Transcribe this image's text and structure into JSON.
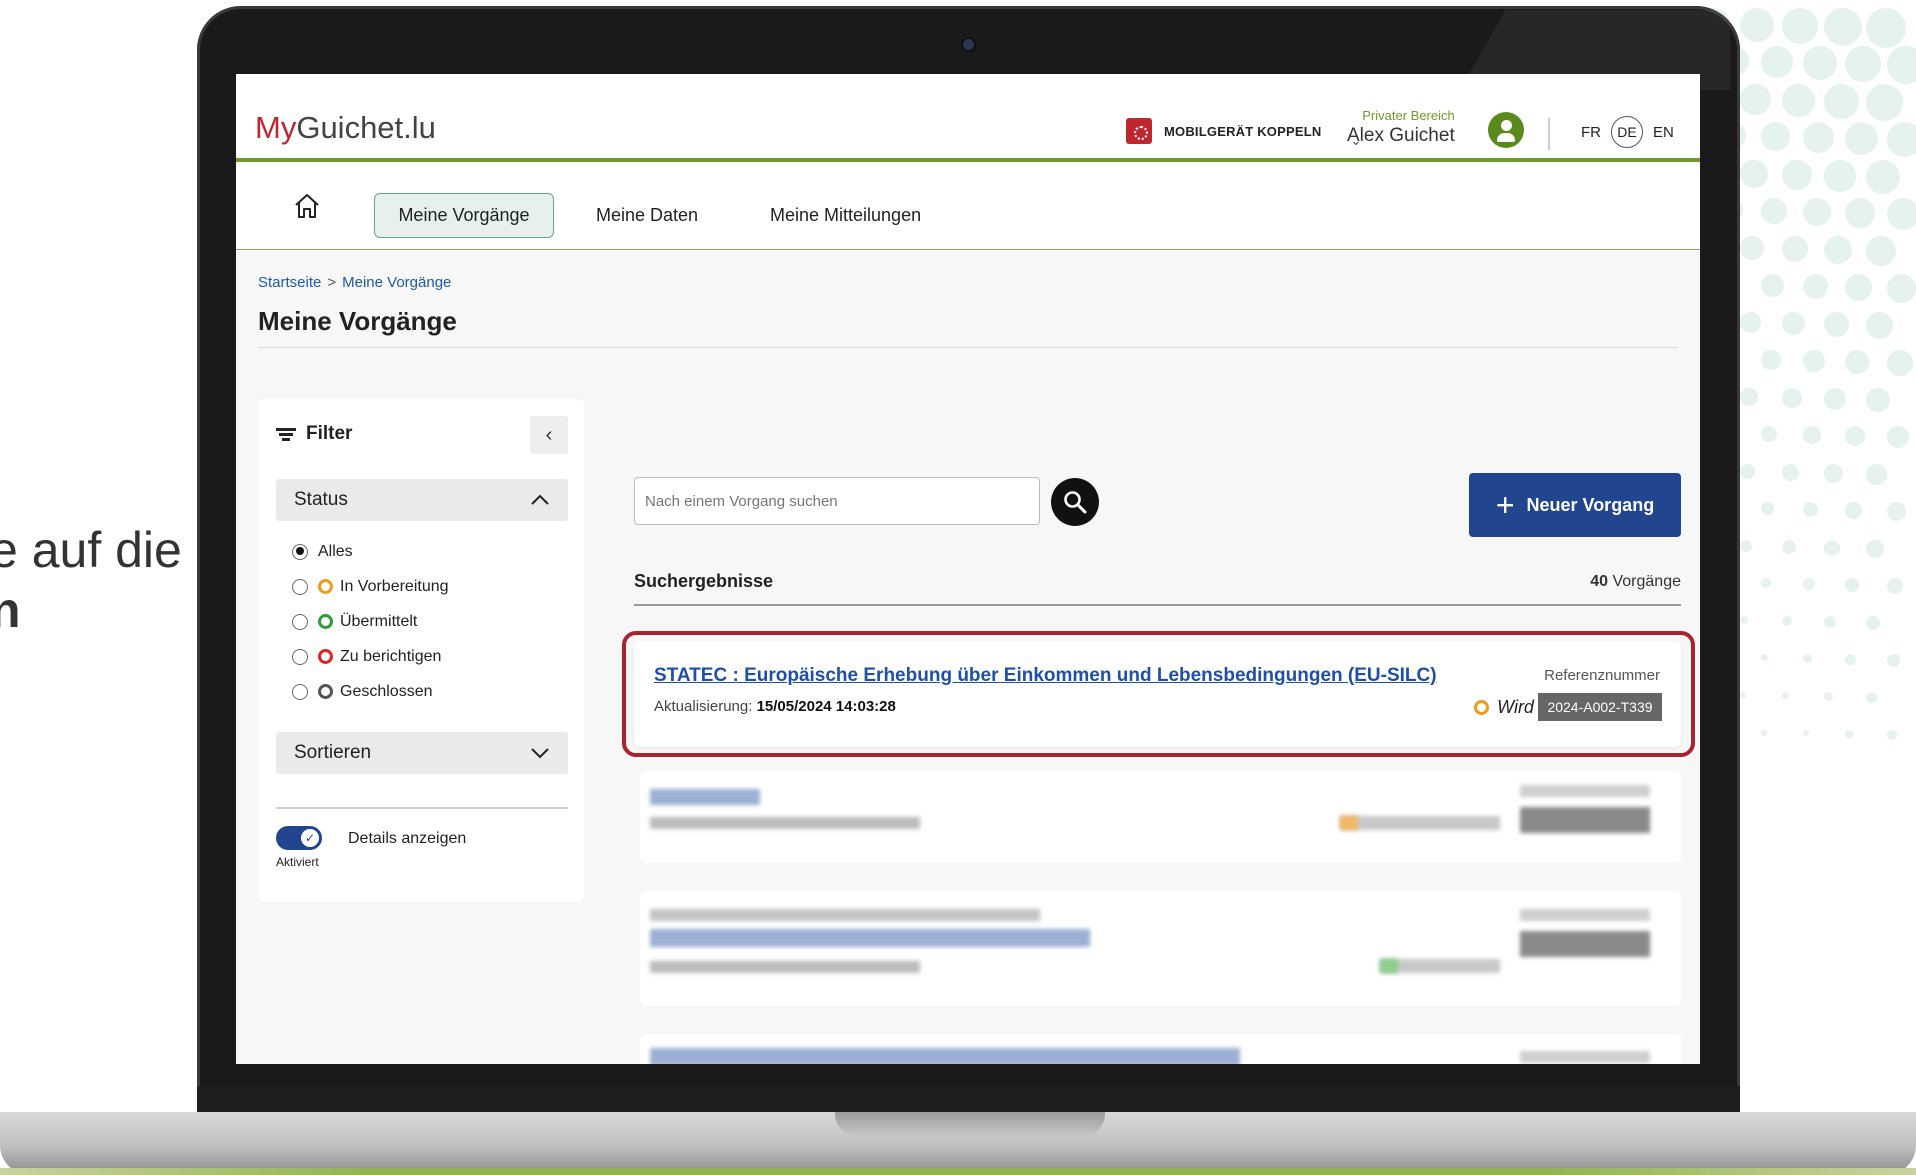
{
  "caption": {
    "line1": "e auf die",
    "line2": "n"
  },
  "header": {
    "logo_my": "My",
    "logo_rest": "Guichet.lu",
    "mobile_button": "MOBILGERÄT KOPPELN",
    "user_area": "Privater Bereich",
    "user_name": "Alex Guichet",
    "languages": [
      "FR",
      "DE",
      "EN"
    ],
    "current_language": "DE"
  },
  "nav": {
    "tabs": [
      {
        "label": "Meine Vorgänge",
        "active": true
      },
      {
        "label": "Meine Daten",
        "active": false
      },
      {
        "label": "Meine Mitteilungen",
        "active": false
      }
    ]
  },
  "breadcrumb": {
    "home": "Startseite",
    "separator": ">",
    "current": "Meine Vorgänge"
  },
  "page_title": "Meine Vorgänge",
  "filter": {
    "title": "Filter",
    "status_label": "Status",
    "options": [
      {
        "label": "Alles",
        "checked": true,
        "color": ""
      },
      {
        "label": "In Vorbereitung",
        "checked": false,
        "color": "#f29a1a"
      },
      {
        "label": "Übermittelt",
        "checked": false,
        "color": "#2e9e3a"
      },
      {
        "label": "Zu berichtigen",
        "checked": false,
        "color": "#e02424"
      },
      {
        "label": "Geschlossen",
        "checked": false,
        "color": "#555555"
      }
    ],
    "sort_label": "Sortieren",
    "details_label": "Details anzeigen",
    "details_state": "Aktiviert"
  },
  "search": {
    "placeholder": "Nach einem Vorgang suchen"
  },
  "new_button": "Neuer Vorgang",
  "results": {
    "heading": "Suchergebnisse",
    "count": "40",
    "count_suffix": "Vorgänge",
    "items": [
      {
        "title": "STATEC : Europäische Erhebung über Einkommen und Lebensbedingungen (EU-SILC)",
        "updated_label": "Aktualisierung:",
        "updated_value": "15/05/2024 14:03:28",
        "status": "Wird vorbereitet",
        "ref_label": "Referenznummer",
        "ref_value": "2024-A002-T339"
      }
    ]
  },
  "colors": {
    "brand_red": "#c0262d",
    "green": "#6f9b2a",
    "primary_blue": "#21458e",
    "highlight": "#a8232e"
  }
}
